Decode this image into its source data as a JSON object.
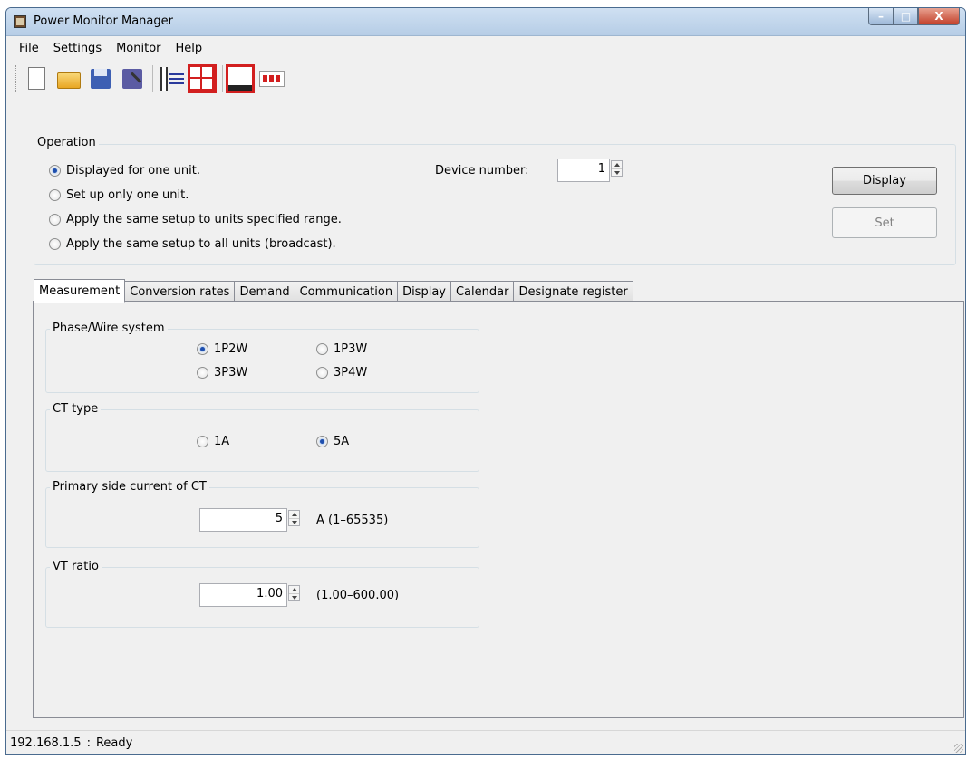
{
  "window": {
    "title": "Power Monitor Manager",
    "controls": {
      "minimize": "–",
      "maximize": "□",
      "close": "X"
    }
  },
  "menu": [
    "File",
    "Settings",
    "Monitor",
    "Help"
  ],
  "toolbar": {
    "icons": [
      "new-file-icon",
      "open-folder-icon",
      "save-icon",
      "save-as-icon",
      "device-list-icon",
      "four-panel-icon",
      "single-panel-icon",
      "multi-unit-icon"
    ]
  },
  "operation": {
    "title": "Operation",
    "options": [
      {
        "label": "Displayed for one unit.",
        "checked": true
      },
      {
        "label": "Set up only one unit.",
        "checked": false
      },
      {
        "label": "Apply the same setup to units specified range.",
        "checked": false
      },
      {
        "label": "Apply the same setup to all units (broadcast).",
        "checked": false
      }
    ],
    "device_number_label": "Device number:",
    "device_number_value": "1",
    "display_button": "Display",
    "set_button": "Set"
  },
  "tabs": [
    "Measurement",
    "Conversion rates",
    "Demand",
    "Communication",
    "Display",
    "Calendar",
    "Designate register"
  ],
  "active_tab": "Measurement",
  "measurement": {
    "phase_wire": {
      "title": "Phase/Wire system",
      "options": [
        {
          "label": "1P2W",
          "checked": true
        },
        {
          "label": "1P3W",
          "checked": false
        },
        {
          "label": "3P3W",
          "checked": false
        },
        {
          "label": "3P4W",
          "checked": false
        }
      ]
    },
    "ct_type": {
      "title": "CT type",
      "options": [
        {
          "label": "1A",
          "checked": false
        },
        {
          "label": "5A",
          "checked": true
        }
      ]
    },
    "primary_current": {
      "title": "Primary side current of CT",
      "value": "5",
      "range": "A (1–65535)"
    },
    "vt_ratio": {
      "title": "VT ratio",
      "value": "1.00",
      "range": "(1.00–600.00)"
    }
  },
  "status": {
    "ip": "192.168.1.5",
    "separator": ":",
    "state": "Ready"
  }
}
